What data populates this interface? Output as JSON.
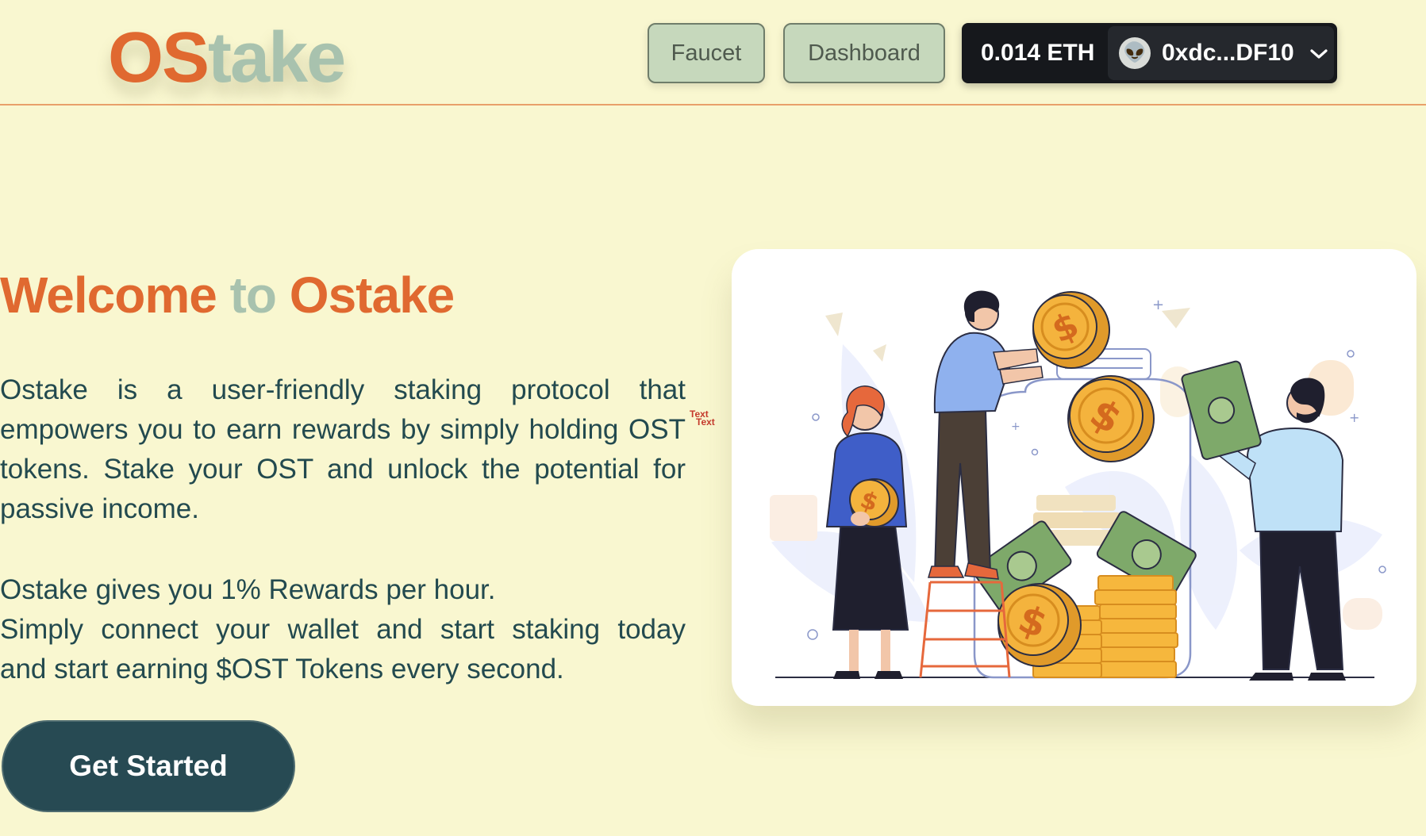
{
  "header": {
    "logo": {
      "part1": "OS",
      "part2": "take"
    },
    "nav": {
      "faucet_label": "Faucet",
      "dashboard_label": "Dashboard"
    },
    "wallet": {
      "balance": "0.014 ETH",
      "address": "0xdc...DF10",
      "avatar_glyph": "👽",
      "chevron": "❯"
    }
  },
  "hero": {
    "title": {
      "part1": "Welcome",
      "part2": "to",
      "part3": "Ostake"
    },
    "paragraph1": "Ostake is a user-friendly staking protocol that empowers you to earn rewards by simply holding OST tokens. Stake your OST and unlock the potential for passive income.",
    "text_mark_line1": "Text",
    "text_mark_line2": "Text",
    "paragraph2": "Ostake gives you 1% Rewards per hour.",
    "paragraph3": "Simply connect your wallet and start staking today",
    "paragraph4": "and start earning $OST Tokens every second.",
    "cta_label": "Get Started"
  },
  "illustration": {
    "coin_symbol": "$",
    "colors": {
      "coin": "#f4b33d",
      "coin_edge": "#e09a2a",
      "cash": "#7ea96a",
      "shirt": "#8fb1ee",
      "jacket": "#3f5ec8",
      "hair": "#e6683c"
    }
  },
  "colors": {
    "brand_orange": "#e06930",
    "brand_sage": "#a8c2ae",
    "background": "#f9f7d0",
    "text": "#234a4f",
    "cta": "#274a53"
  }
}
